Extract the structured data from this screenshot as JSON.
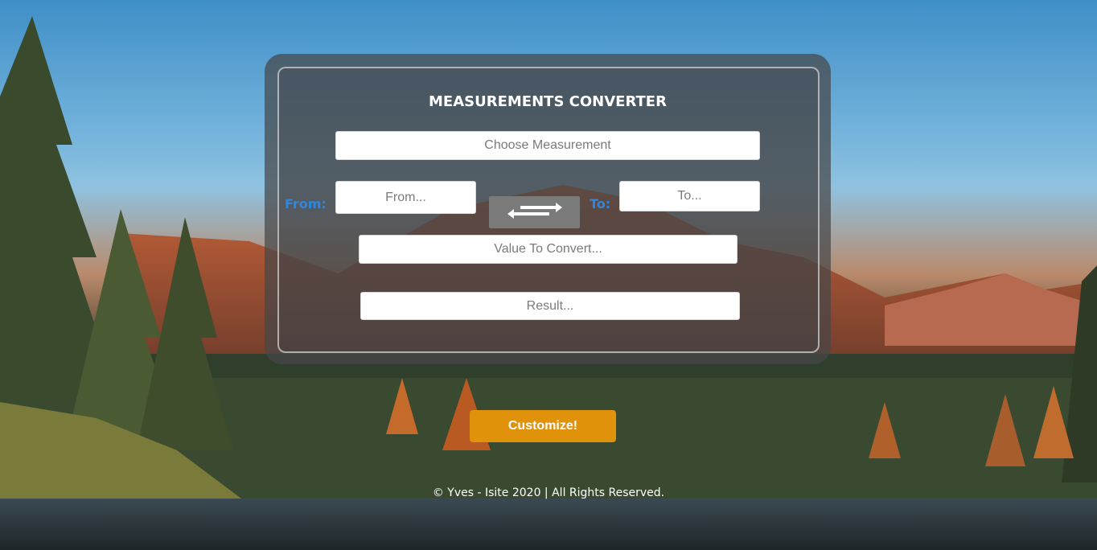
{
  "converter": {
    "title": "MEASUREMENTS CONVERTER",
    "measurement_placeholder": "Choose Measurement",
    "from_label": "From:",
    "from_placeholder": "From...",
    "to_label": "To:",
    "to_placeholder": "To...",
    "value_placeholder": "Value To Convert...",
    "result_placeholder": "Result...",
    "swap_icon": "swap-arrows-icon"
  },
  "actions": {
    "customize_label": "Customize!"
  },
  "footer": {
    "text": "© Yves - Isite 2020 | All Rights Reserved."
  },
  "colors": {
    "label_accent": "#2f86e0",
    "customize_button": "#e0920a",
    "swap_button": "#7a7a7a"
  }
}
